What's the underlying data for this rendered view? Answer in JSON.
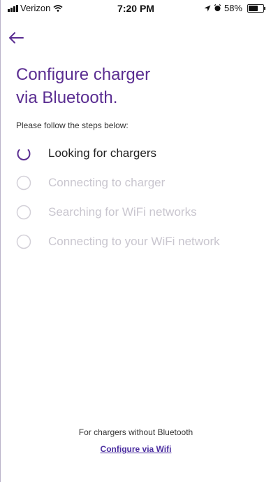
{
  "status_bar": {
    "carrier": "Verizon",
    "time": "7:20 PM",
    "battery": "58%",
    "icons": [
      "signal-icon",
      "wifi-icon",
      "location-icon",
      "alarm-icon",
      "battery-icon"
    ]
  },
  "header": {
    "back_icon": "arrow-left-icon"
  },
  "title": {
    "line1": "Configure charger",
    "line2": "via Bluetooth."
  },
  "subtitle": "Please follow the steps below:",
  "steps": [
    {
      "label": "Looking for chargers",
      "state": "active"
    },
    {
      "label": "Connecting to charger",
      "state": "pending"
    },
    {
      "label": "Searching for WiFi networks",
      "state": "pending"
    },
    {
      "label": "Connecting to your WiFi network",
      "state": "pending"
    }
  ],
  "footer": {
    "text": "For chargers without Bluetooth",
    "link": "Configure via Wifi"
  },
  "colors": {
    "accent": "#5a2d91",
    "link": "#4b2ea0",
    "pending": "#c9c6cf"
  }
}
